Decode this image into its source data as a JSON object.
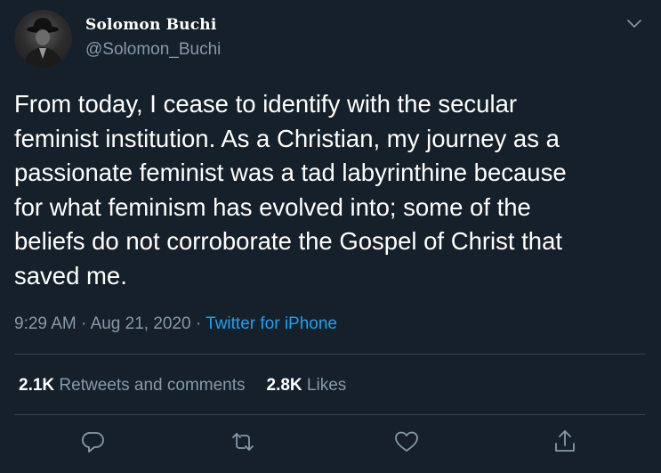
{
  "user": {
    "name": "Solomon Buchi",
    "handle": "@Solomon_Buchi"
  },
  "tweet": {
    "text": "From today, I cease to identify with the secular\nfeminist institution. As a Christian, my journey as a\npassionate feminist was a tad labyrinthine because\nfor what feminism has evolved into; some of the\nbeliefs do not corroborate the Gospel of Christ that\nsaved me.",
    "time": "9:29 AM",
    "separator1": " · ",
    "date": "Aug 21, 2020",
    "separator2": " · ",
    "source": "Twitter for iPhone"
  },
  "stats": {
    "retweets_count": "2.1K",
    "retweets_label": " Retweets and comments",
    "likes_count": "2.8K",
    "likes_label": " Likes"
  },
  "icons": {
    "more": "chevron-down-icon",
    "reply": "reply-icon",
    "retweet": "retweet-icon",
    "like": "heart-icon",
    "share": "share-icon"
  },
  "colors": {
    "background": "#15202b",
    "secondary_text": "#8899a6",
    "link": "#1da1f2",
    "divider": "#38444d"
  }
}
